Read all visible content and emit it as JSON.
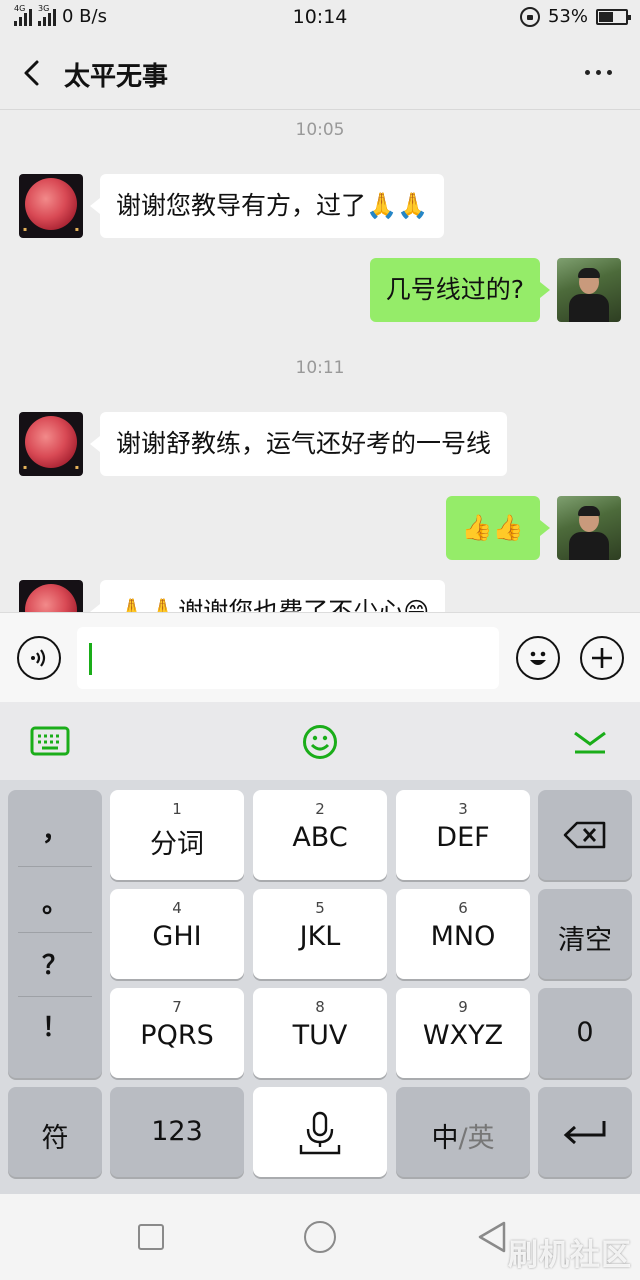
{
  "status_bar": {
    "network_label_1": "4G",
    "network_label_2": "3G",
    "speed": "0 B/s",
    "time": "10:14",
    "battery_pct": "53%",
    "battery_level": 0.53
  },
  "header": {
    "title": "太平无事"
  },
  "chat": {
    "messages": [
      {
        "type": "time",
        "text": "10:05"
      },
      {
        "type": "in",
        "text": "谢谢您教导有方，过了🙏🙏"
      },
      {
        "type": "out",
        "text": "几号线过的?"
      },
      {
        "type": "time",
        "text": "10:11"
      },
      {
        "type": "in",
        "text": "谢谢舒教练，运气还好考的一号线"
      },
      {
        "type": "out",
        "text": "👍👍"
      },
      {
        "type": "in",
        "text": "🙏🙏谢谢您也费了不少心😁"
      }
    ]
  },
  "input": {
    "value": ""
  },
  "keyboard": {
    "punctuation": [
      "，",
      "。",
      "？",
      "！"
    ],
    "keys": [
      {
        "num": "1",
        "label": "分词"
      },
      {
        "num": "2",
        "label": "ABC"
      },
      {
        "num": "3",
        "label": "DEF"
      },
      {
        "num": "4",
        "label": "GHI"
      },
      {
        "num": "5",
        "label": "JKL"
      },
      {
        "num": "6",
        "label": "MNO"
      },
      {
        "num": "7",
        "label": "PQRS"
      },
      {
        "num": "8",
        "label": "TUV"
      },
      {
        "num": "9",
        "label": "WXYZ"
      }
    ],
    "clear_label": "清空",
    "zero_label": "0",
    "symbol_label": "符",
    "numeric_label": "123",
    "lang_zh": "中",
    "lang_sep": "/",
    "lang_en": "英"
  },
  "watermark": "刷机社区",
  "colors": {
    "accent": "#1aad19",
    "bubble_out": "#95ec69",
    "bubble_in": "#ffffff"
  }
}
